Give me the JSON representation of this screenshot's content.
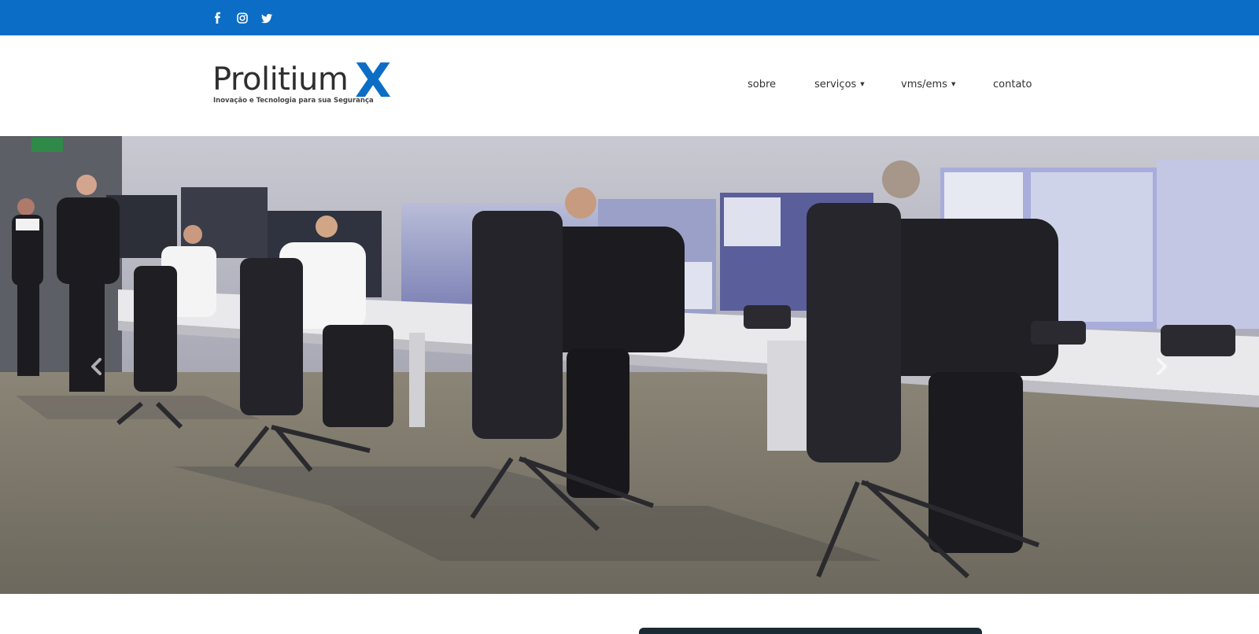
{
  "topbar": {
    "color": "#0c6dc6",
    "social": [
      {
        "icon": "facebook-icon"
      },
      {
        "icon": "instagram-icon"
      },
      {
        "icon": "twitter-icon"
      }
    ]
  },
  "logo": {
    "word": "Prolitium",
    "x": "X",
    "tagline": "Inovação e Tecnologia para sua Segurança",
    "accent_color": "#0c6dc6"
  },
  "nav": {
    "items": [
      {
        "label": "sobre",
        "has_dropdown": false
      },
      {
        "label": "serviços",
        "has_dropdown": true
      },
      {
        "label": "vms/ems",
        "has_dropdown": true
      },
      {
        "label": "contato",
        "has_dropdown": false
      }
    ]
  },
  "slider": {
    "image": "security-control-room-photo",
    "prev_icon": "chevron-left-icon",
    "next_icon": "chevron-right-icon"
  }
}
